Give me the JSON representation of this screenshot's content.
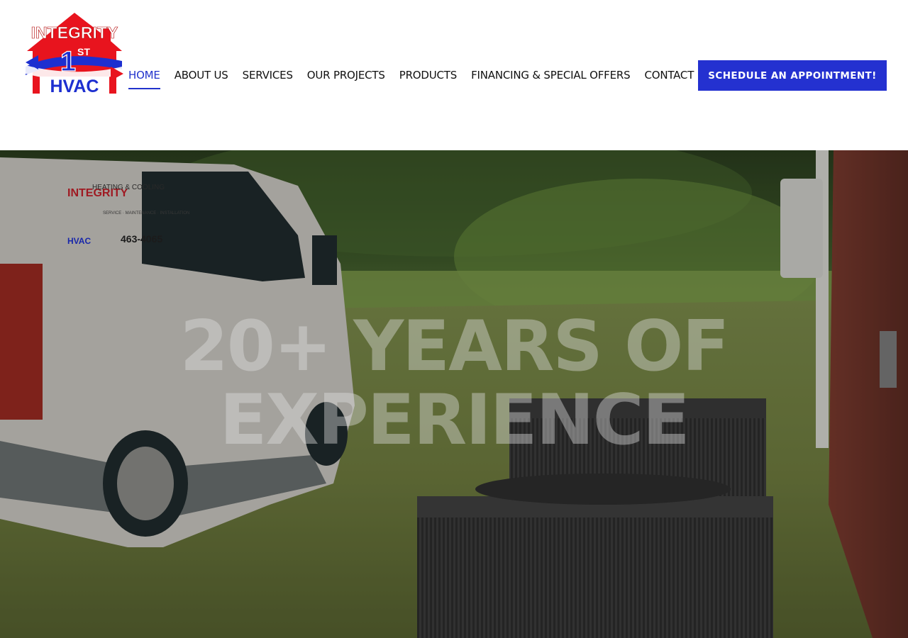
{
  "logo": {
    "line1": "INTEGRITY",
    "number": "1",
    "superscript": "ST",
    "line2": "HVAC"
  },
  "nav": {
    "items": [
      {
        "label": "HOME",
        "active": true
      },
      {
        "label": "ABOUT US",
        "active": false
      },
      {
        "label": "SERVICES",
        "active": false
      },
      {
        "label": "OUR PROJECTS",
        "active": false
      },
      {
        "label": "PRODUCTS",
        "active": false
      },
      {
        "label": "FINANCING & SPECIAL OFFERS",
        "active": false
      },
      {
        "label": "CONTACT US",
        "active": false
      }
    ]
  },
  "cta": {
    "label": "SCHEDULE AN APPOINTMENT!"
  },
  "hero": {
    "heading": "20+ YEARS OF EXPERIENCE",
    "van_decal_line1": "INTEGRITY",
    "van_decal_line2": "HVAC",
    "van_decal_company": "HEATING & COOLING",
    "van_decal_services": "SERVICE · MAINTENANCE · INSTALLATION",
    "van_decal_phone": "463-4065"
  },
  "colors": {
    "accent": "#2431d0",
    "active_nav": "#2233cc",
    "logo_red": "#e8141e",
    "logo_blue": "#1d2fd0"
  }
}
